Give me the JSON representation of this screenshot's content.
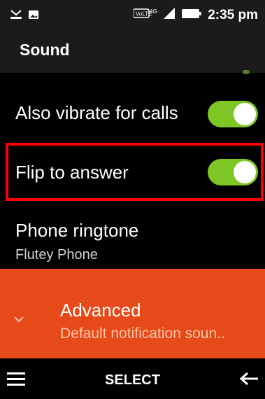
{
  "status": {
    "time": "2:35 pm",
    "network": "VoLTE 4G"
  },
  "app": {
    "title": "Sound"
  },
  "settings": [
    {
      "label": "Also vibrate for calls",
      "toggle": true
    },
    {
      "label": "Flip to answer",
      "toggle": true,
      "highlighted": true
    },
    {
      "label": "Phone ringtone",
      "sub": "Flutey Phone"
    }
  ],
  "advanced": {
    "title": "Advanced",
    "sub": "Default notification soun.."
  },
  "softkeys": {
    "center": "SELECT"
  },
  "icons": {
    "status_left": [
      "missed-call-icon",
      "image-notification-icon"
    ],
    "status_right": [
      "volte-icon",
      "signal-icon",
      "battery-icon"
    ],
    "expand": "chevron-down-icon",
    "menu": "hamburger-menu-icon",
    "back": "arrow-left-icon"
  },
  "colors": {
    "toggle_on": "#7ec623",
    "highlight": "#ff0000",
    "advanced_bg": "#e64a19",
    "bar_bg": "#1b1b1b"
  }
}
